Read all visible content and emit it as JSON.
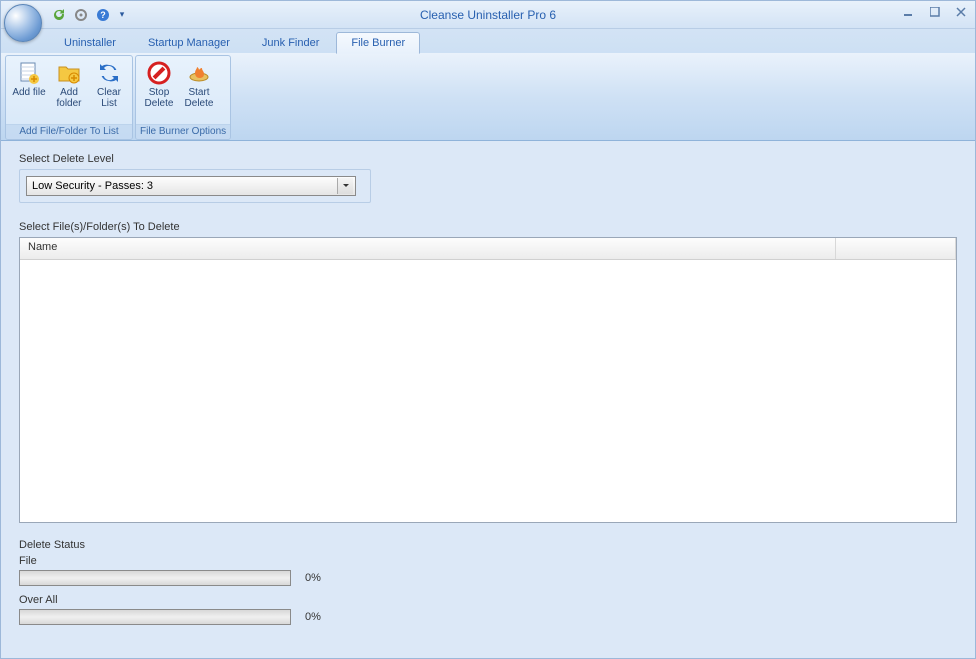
{
  "window": {
    "title": "Cleanse Uninstaller Pro 6"
  },
  "tabs": {
    "uninstaller": "Uninstaller",
    "startup": "Startup Manager",
    "junk": "Junk Finder",
    "fileburner": "File Burner"
  },
  "ribbon": {
    "group1_label": "Add File/Folder To List",
    "group2_label": "File Burner Options",
    "add_file": "Add file",
    "add_folder": "Add folder",
    "clear_list": "Clear List",
    "stop_delete": "Stop Delete",
    "start_delete": "Start Delete"
  },
  "content": {
    "delete_level_label": "Select Delete Level",
    "delete_level_value": "Low Security - Passes: 3",
    "select_files_label": "Select File(s)/Folder(s) To Delete",
    "column_name": "Name",
    "delete_status_label": "Delete Status",
    "file_label": "File",
    "overall_label": "Over All",
    "file_progress": "0%",
    "overall_progress": "0%"
  }
}
